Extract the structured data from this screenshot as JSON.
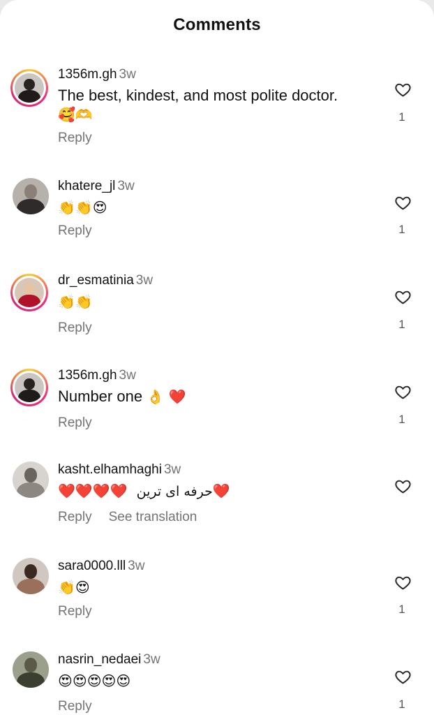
{
  "header": {
    "title": "Comments"
  },
  "comments": [
    {
      "username": "1356m.gh",
      "time": "3w",
      "text": "The best, kindest, and most polite doctor.",
      "emojis_line2": "🥰🫶",
      "reply": "Reply",
      "likes": "1",
      "story_ring": true,
      "avatar": {
        "bg": "#c9c6c2",
        "head": "#2a2220",
        "body": "#1f1b1a"
      }
    },
    {
      "username": "khatere_jl",
      "time": "3w",
      "emojis": "👏👏😍",
      "reply": "Reply",
      "likes": "1",
      "story_ring": false,
      "avatar": {
        "bg": "#b7b1ab",
        "head": "#8a8078",
        "body": "#2f2b2a"
      }
    },
    {
      "username": "dr_esmatinia",
      "time": "3w",
      "emojis": "👏👏",
      "reply": "Reply",
      "likes": "1",
      "story_ring": true,
      "avatar": {
        "bg": "#d8c6b6",
        "head": "#e6c3a3",
        "body": "#b0122a"
      }
    },
    {
      "username": "1356m.gh",
      "time": "3w",
      "text": "Number one",
      "emojis": "👌 ❤️",
      "reply": "Reply",
      "likes": "1",
      "story_ring": true,
      "avatar": {
        "bg": "#c9c6c2",
        "head": "#2a2220",
        "body": "#1f1b1a"
      }
    },
    {
      "username": "kasht.elhamhaghi",
      "time": "3w",
      "emojis": "❤️❤️❤️❤️",
      "rtl_text": "حرفه ای ترین",
      "reply": "Reply",
      "translate": "See translation",
      "story_ring": false,
      "avatar": {
        "bg": "#d7d4d0",
        "head": "#6b6560",
        "body": "#8d8781"
      }
    },
    {
      "username": "sara0000.lll",
      "time": "3w",
      "emojis": "👏😍",
      "reply": "Reply",
      "likes": "1",
      "story_ring": false,
      "avatar": {
        "bg": "#cfc7c0",
        "head": "#3a2a22",
        "body": "#9a6f5b"
      }
    },
    {
      "username": "nasrin_nedaei",
      "time": "3w",
      "emojis": "😍😍😍😍😍",
      "reply": "Reply",
      "likes": "1",
      "story_ring": false,
      "avatar": {
        "bg": "#9aa08c",
        "head": "#5b5a49",
        "body": "#3a3f2f"
      }
    }
  ],
  "colors": {
    "secondary_text": "#737373",
    "heart_outline": "#262626"
  }
}
